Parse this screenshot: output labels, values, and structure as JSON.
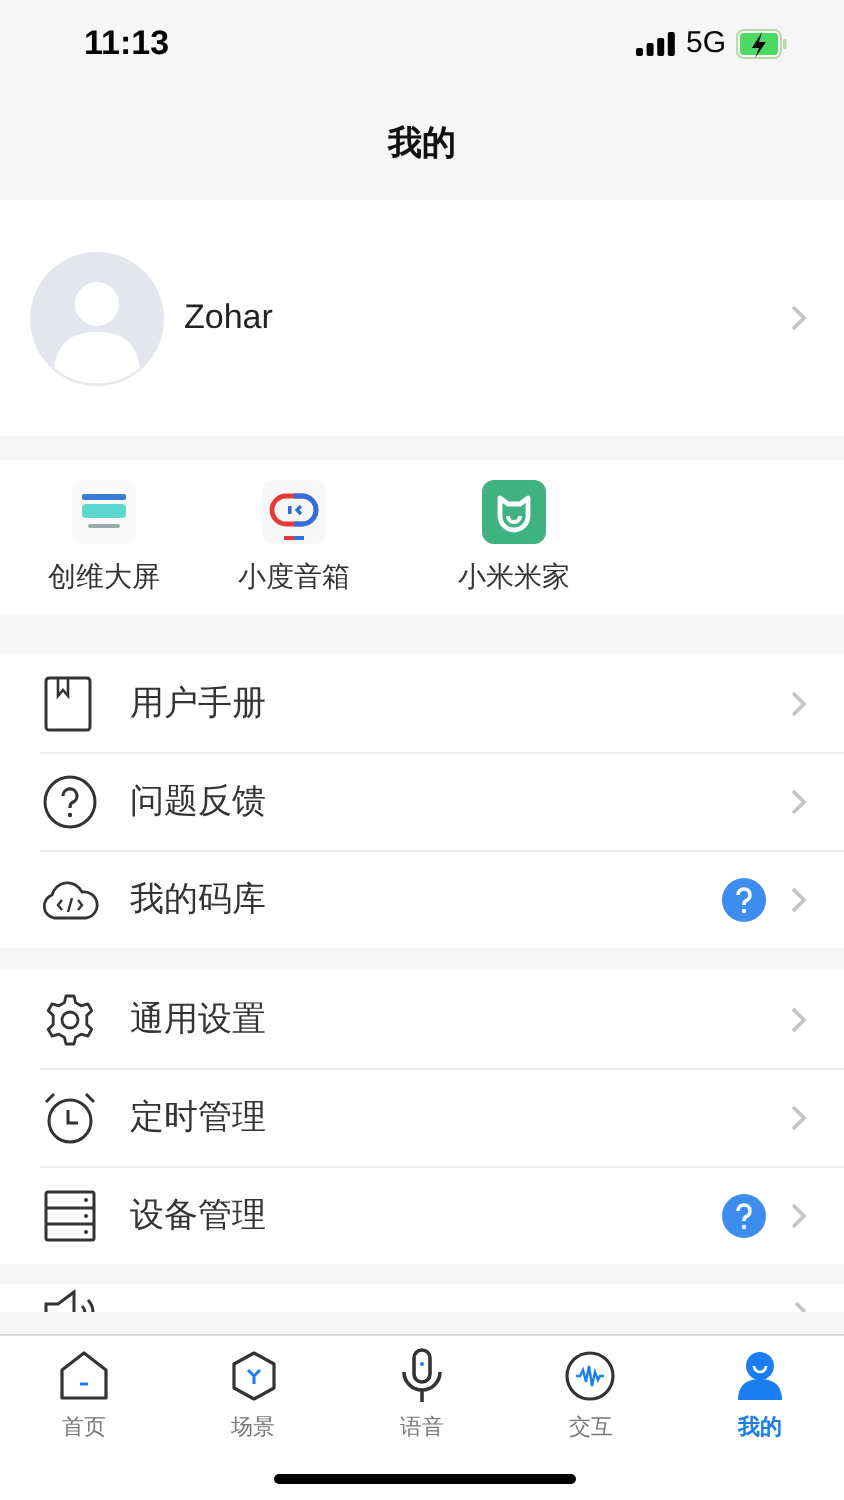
{
  "status_bar": {
    "time": "11:13",
    "network": "5G",
    "charging": true
  },
  "header": {
    "title": "我的"
  },
  "profile": {
    "name": "Zohar"
  },
  "apps": [
    {
      "label": "创维大屏",
      "kind": "skyworth"
    },
    {
      "label": "小度音箱",
      "kind": "xiaodu"
    },
    {
      "label": "小米米家",
      "kind": "mijia"
    }
  ],
  "menu_groups": [
    [
      {
        "label": "用户手册",
        "kind": "book",
        "help_badge": false
      },
      {
        "label": "问题反馈",
        "kind": "question",
        "help_badge": false
      },
      {
        "label": "我的码库",
        "kind": "cloud",
        "help_badge": true
      }
    ],
    [
      {
        "label": "通用设置",
        "kind": "gear",
        "help_badge": false
      },
      {
        "label": "定时管理",
        "kind": "alarm",
        "help_badge": false
      },
      {
        "label": "设备管理",
        "kind": "server",
        "help_badge": true
      }
    ]
  ],
  "partial_row": {
    "kind": "speaker"
  },
  "tabs": [
    {
      "label": "首页",
      "kind": "home",
      "selected": false
    },
    {
      "label": "场景",
      "kind": "scene",
      "selected": false
    },
    {
      "label": "语音",
      "kind": "voice",
      "selected": false
    },
    {
      "label": "交互",
      "kind": "interact",
      "selected": false
    },
    {
      "label": "我的",
      "kind": "me",
      "selected": true
    }
  ]
}
